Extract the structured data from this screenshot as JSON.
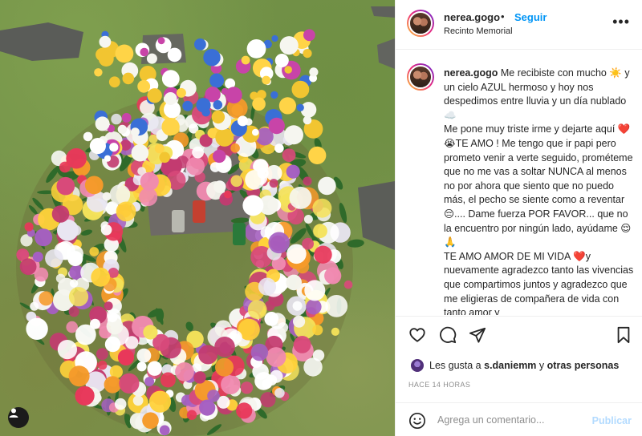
{
  "post": {
    "username": "nerea.gogo",
    "follow_label": "Seguir",
    "location": "Recinto Memorial",
    "more_icon": "more-horizontal-icon",
    "caption_paragraphs": [
      "Me recibiste con mucho ☀️ y un cielo AZUL hermoso y hoy nos despedimos entre lluvia y un día nublado ☁️",
      "Me pone muy triste irme y dejarte aquí ❤️😭TE AMO ! Me tengo que ir papi pero prometo venir a verte seguido, prométeme que no me vas a soltar NUNCA al menos no por ahora que siento que no puedo más, el pecho se siente como a reventar 😔.... Dame fuerza POR FAVOR... que no la encuentro por ningún lado, ayúdame 😌🙏",
      "TE AMO AMOR DE MI VIDA ❤️y nuevamente agradezco tanto las vivencias que compartimos juntos y agradezco que me eligieras de compañera de vida con tanto amor y"
    ],
    "likes_prefix": "Les gusta a",
    "likes_user": "s.daniemm",
    "likes_conj": "y",
    "likes_others": "otras personas",
    "timestamp": "HACE 14 HORAS",
    "comment_placeholder": "Agrega un comentario...",
    "publish_label": "Publicar"
  },
  "icons": {
    "like": "heart-icon",
    "comment": "comment-icon",
    "share": "share-icon",
    "save": "bookmark-icon",
    "emoji": "emoji-icon",
    "user_tag": "user-tag-icon"
  },
  "colors": {
    "accent": "#0095f6",
    "publish_disabled": "#b3dbff",
    "text": "#262626",
    "muted": "#8e8e8e",
    "divider": "#efefef"
  }
}
